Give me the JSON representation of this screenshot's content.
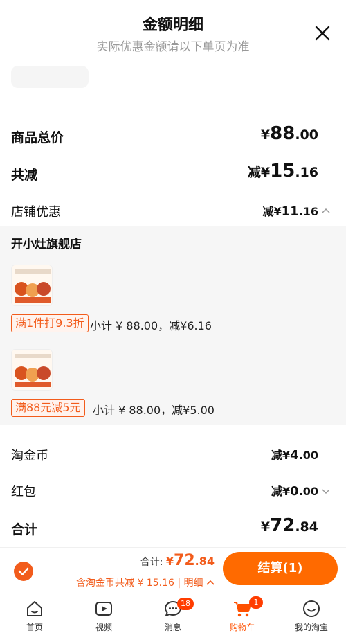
{
  "header": {
    "title": "金额明细",
    "subtitle": "实际优惠金额请以下单页为准"
  },
  "summary": {
    "goods_total_label": "商品总价",
    "goods_total_yen": "¥",
    "goods_total_int": "88",
    "goods_total_dec": ".00",
    "discount_label": "共减",
    "discount_prefix": "减¥",
    "discount_int": "15",
    "discount_dec": ".16",
    "store_discount_label": "店铺优惠",
    "store_discount_prefix": "减¥",
    "store_discount_int": "11",
    "store_discount_dec": ".16"
  },
  "shop": {
    "name": "开小灶旗舰店",
    "items": [
      {
        "tag": "满1件打9.3折",
        "subtotal": "小计 ¥ 88.00，减¥6.16"
      },
      {
        "tag": "满88元减5元",
        "subtotal": "小计 ¥ 88.00，减¥5.00"
      }
    ]
  },
  "coins": {
    "label": "淘金币",
    "prefix": "减¥",
    "int": "4",
    "dec": ".00"
  },
  "redpacket": {
    "label": "红包",
    "prefix": "减¥",
    "int": "0",
    "dec": ".00"
  },
  "total": {
    "label": "合计",
    "yen": "¥",
    "int": "72",
    "dec": ".84"
  },
  "bottom": {
    "total_label": "合计:",
    "total_yen": "¥",
    "total_int": "72",
    "total_dec": ".84",
    "saving_text": "含淘金币共减 ¥ 15.16 | 明细",
    "checkout_label": "结算(1)"
  },
  "tabbar": {
    "tabs": [
      {
        "label": "首页",
        "icon": "home-icon"
      },
      {
        "label": "视频",
        "icon": "video-icon"
      },
      {
        "label": "消息",
        "icon": "message-icon",
        "badge": "18"
      },
      {
        "label": "购物车",
        "icon": "cart-icon",
        "badge": "1"
      },
      {
        "label": "我的淘宝",
        "icon": "profile-icon"
      }
    ]
  },
  "colors": {
    "accent": "#f25c1c",
    "checkout": "#ff6a00",
    "badge": "#ff3d00"
  }
}
